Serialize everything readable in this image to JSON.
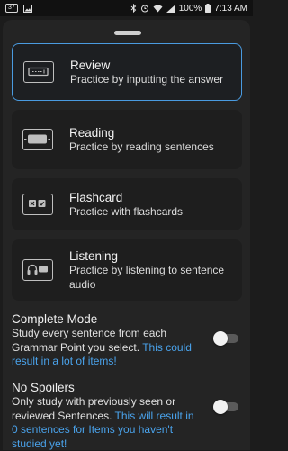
{
  "status_bar": {
    "notification_count": "37",
    "battery": "100%",
    "time": "7:13 AM",
    "icons": [
      "image-icon",
      "bluetooth-icon",
      "alarm-icon",
      "wifi-icon",
      "signal-icon",
      "battery-icon"
    ]
  },
  "modes": [
    {
      "title": "Review",
      "description": "Practice by inputting the answer",
      "icon": "keyboard-input-icon",
      "selected": true
    },
    {
      "title": "Reading",
      "description": "Practice by reading sentences",
      "icon": "reading-icon",
      "selected": false
    },
    {
      "title": "Flashcard",
      "description": "Practice with flashcards",
      "icon": "flashcard-icon",
      "selected": false
    },
    {
      "title": "Listening",
      "description": "Practice by listening to sentence audio",
      "icon": "headphones-icon",
      "selected": false
    }
  ],
  "options": {
    "complete_mode": {
      "title": "Complete Mode",
      "description": "Study every sentence from each Grammar Point you select.",
      "note": "This could result in a lot of items!",
      "enabled": false
    },
    "no_spoilers": {
      "title": "No Spoilers",
      "description": "Only study with previously seen or reviewed Sentences.",
      "note": "This will result in 0 sentences for Items you haven't studied yet!",
      "enabled": false
    }
  },
  "colors": {
    "accent": "#4a9be0",
    "background": "#1c1c1c",
    "sheet": "#242424"
  }
}
